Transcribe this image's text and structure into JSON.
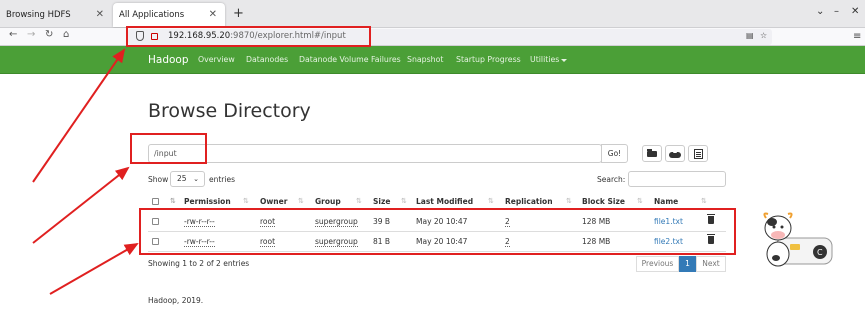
{
  "browser": {
    "tabs": [
      {
        "label": "Browsing HDFS"
      },
      {
        "label": "All Applications"
      }
    ],
    "url_host": "192.168.95.20",
    "url_rest": ":9870/explorer.html#/input"
  },
  "hadoop_nav": {
    "brand": "Hadoop",
    "items": [
      "Overview",
      "Datanodes",
      "Datanode Volume Failures",
      "Snapshot",
      "Startup Progress",
      "Utilities"
    ]
  },
  "page": {
    "title": "Browse Directory",
    "path_value": "/input",
    "go_label": "Go!",
    "show_label": "Show",
    "entries_per_page": "25",
    "entries_label": "entries",
    "search_label": "Search:"
  },
  "table": {
    "columns": [
      "Permission",
      "Owner",
      "Group",
      "Size",
      "Last Modified",
      "Replication",
      "Block Size",
      "Name"
    ],
    "rows": [
      {
        "permission": "-rw-r--r--",
        "owner": "root",
        "group": "supergroup",
        "size": "39 B",
        "modified": "May 20 10:47",
        "replication": "2",
        "block_size": "128 MB",
        "name": "file1.txt"
      },
      {
        "permission": "-rw-r--r--",
        "owner": "root",
        "group": "supergroup",
        "size": "81 B",
        "modified": "May 20 10:47",
        "replication": "2",
        "block_size": "128 MB",
        "name": "file2.txt"
      }
    ],
    "info": "Showing 1 to 2 of 2 entries",
    "pager": {
      "previous": "Previous",
      "page": "1",
      "next": "Next"
    }
  },
  "footer": "Hadoop, 2019.",
  "colors": {
    "navbar": "#4b9f37",
    "annotation": "#e02020",
    "link": "#337ab7"
  }
}
